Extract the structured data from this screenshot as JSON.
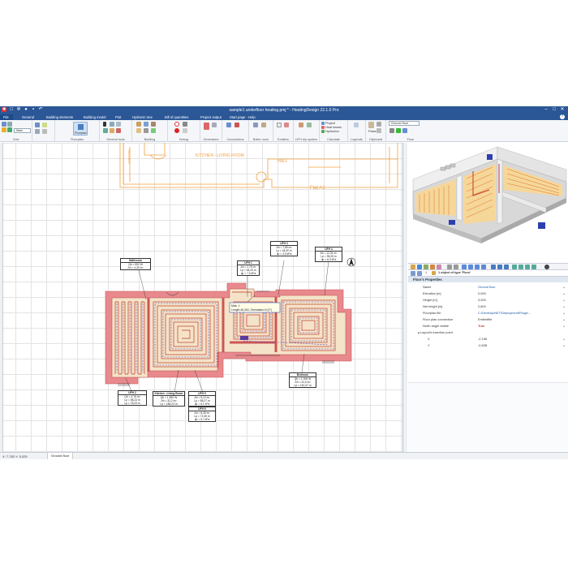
{
  "app": {
    "title": "sample1 underfloor heating.pmj * - HeatingDesign 22.1.0 Pro"
  },
  "tabs": [
    "File",
    "General",
    "Building elements",
    "Building model",
    "Plot",
    "Hydronic tree",
    "Bill of quantities",
    "Project output",
    "Start page - Help"
  ],
  "ribbon_groups": [
    "Grid",
    "Floorplan",
    "General tools",
    "Building",
    "Debug",
    "Generators",
    "Connections",
    "Boiler room",
    "Emitters",
    "UFH dry system",
    "Calculate",
    "Legends",
    "Clipboard",
    "Floor"
  ],
  "ribbon": {
    "snap_combo": "Main",
    "floorplan_button": "Floorplan",
    "calc_items": [
      "Project",
      "Heat losses",
      "Hydronics"
    ],
    "paste_label": "Paste",
    "floor_combo": "Ground floor"
  },
  "plan": {
    "labels": {
      "kitchen_living_top": "KITCHEN - LIVING ROOM",
      "hall": "HALL",
      "flat": "Flat A1",
      "hallway_vertical": "HALLWAY"
    },
    "tooltip": [
      "Matr. 1",
      "Length:46,300, Orientation:N (0°)"
    ],
    "tags": [
      {
        "title": "Bathroom",
        "lines": [
          "Qb = 592 W",
          "Ah = 4,30 m²"
        ]
      },
      {
        "title": "UFH 1",
        "lines": [
          "Ah = 2,76 m²",
          "Lp = 54,23 m",
          "dp = 7,0 kPa"
        ]
      },
      {
        "title": "UFH 2",
        "lines": [
          "Qh = 4,76 m²",
          "Lp = 58,23 m",
          "Lp = 78,23 m"
        ]
      },
      {
        "title": "UFH 3",
        "lines": [
          "Ah = 7,89 m²",
          "Lp = 46,30 m",
          "dp = 3,0 kPa"
        ]
      },
      {
        "title": "UFH 4",
        "lines": [
          "Ah = 12,31 m²",
          "Lp = 95,25 m",
          "dp = 8,3 kPa"
        ]
      },
      {
        "title": "Kitchen - Living Room",
        "lines": [
          "Qh = 1 852 W",
          "Ah = 32,2 m²",
          "Lp = 188,23 m"
        ]
      },
      {
        "title": "UFH 5",
        "lines": [
          "Ah = 9,12 m²",
          "Lp = 88,27 m",
          "dp = 6,1 kPa"
        ]
      },
      {
        "title": "UFH 6",
        "lines": [
          "Ah = 8,45 m²",
          "Lp = 72,45 m",
          "dp = 5,7 kPa"
        ]
      },
      {
        "title": "Bedroom",
        "lines": [
          "Qh = 1 006 W",
          "Ah = 22,0 m²",
          "Lp = 140,37 m"
        ]
      }
    ]
  },
  "properties": {
    "toolbar_count": "1",
    "selection_label": "1 object of type 'Floor'",
    "header": "Floor's Properties",
    "rows": [
      {
        "key": "Name",
        "value": "Ground floor",
        "style": "hi"
      },
      {
        "key": "Elevation [m]",
        "value": "0,000",
        "style": ""
      },
      {
        "key": "Height [m]",
        "value": "3,000",
        "style": ""
      },
      {
        "key": "Net height [m]",
        "value": "2,800",
        "style": ""
      },
      {
        "key": "Floorplan file",
        "value": "C:\\Develop\\NET\\Deployment\\Plugin...",
        "style": "hi"
      },
      {
        "key": "Floor plan connection",
        "value": "Embedfile",
        "style": ""
      },
      {
        "key": "North angle visible",
        "value": "True",
        "style": "red"
      },
      {
        "key": "Layout's insertion point",
        "value": "",
        "style": ""
      },
      {
        "key": "X",
        "value": "-2,196",
        "style": ""
      },
      {
        "key": "Y",
        "value": "-0,838",
        "style": ""
      }
    ]
  },
  "status": {
    "coords": "X: 7,783 Y: 5,025",
    "floor_tab": "Ground floor"
  },
  "colors": {
    "titlebar": "#2b5797",
    "wall": "#e8898e",
    "floor_fill": "#f4e3c8",
    "pipe": "#c0392b",
    "return_pipe": "#4a4ad0",
    "arch_lines": "#f0a040"
  }
}
